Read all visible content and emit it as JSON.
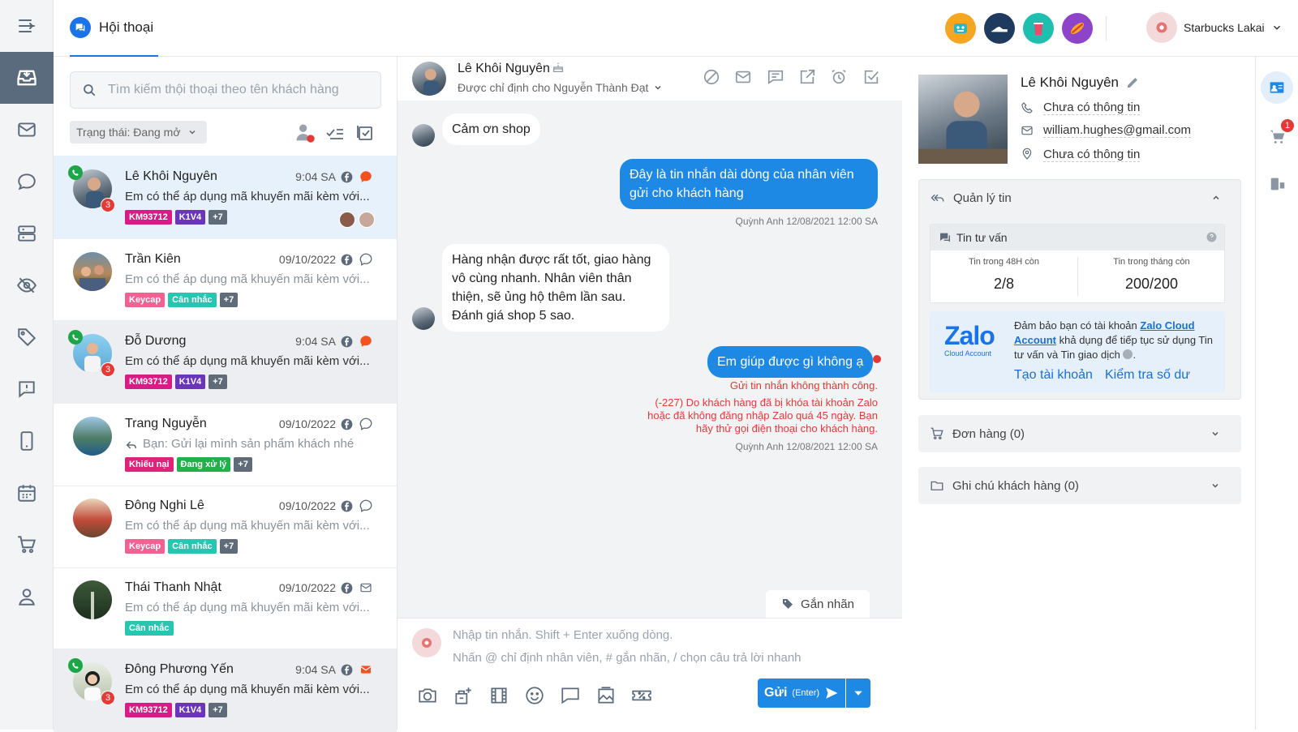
{
  "app": {
    "tab_title": "Hội thoại"
  },
  "account": {
    "name": "Starbucks Lakai"
  },
  "list": {
    "search_placeholder": "Tìm kiếm thội thoại theo tên khách hàng",
    "status_filter": "Trạng thái: Đang mở",
    "conversations": [
      {
        "name": "Lê Khôi Nguyên",
        "time": "9:04 SA",
        "preview": "Em có thể áp dụng mã khuyến mãi kèm với...",
        "tags": [
          {
            "text": "KM93712",
            "color": "#d81b86"
          },
          {
            "text": "K1V4",
            "color": "#6a35b8"
          },
          {
            "text": "+7",
            "color": "#5f6b78"
          }
        ],
        "badge": "3"
      },
      {
        "name": "Trần Kiên",
        "time": "09/10/2022",
        "preview": "Em có thể áp dụng mã khuyến mãi kèm với...",
        "tags": [
          {
            "text": "Keycap",
            "color": "#f06292"
          },
          {
            "text": "Cân nhắc",
            "color": "#26c6b0"
          },
          {
            "text": "+7",
            "color": "#5f6b78"
          }
        ]
      },
      {
        "name": "Đỗ Dương",
        "time": "9:04 SA",
        "preview": "Em có thể áp dụng mã khuyến mãi kèm với...",
        "tags": [
          {
            "text": "KM93712",
            "color": "#d81b86"
          },
          {
            "text": "K1V4",
            "color": "#6a35b8"
          },
          {
            "text": "+7",
            "color": "#5f6b78"
          }
        ],
        "badge": "3"
      },
      {
        "name": "Trang Nguyễn",
        "time": "09/10/2022",
        "preview": "Bạn: Gửi lại mình sản phẩm khách nhé",
        "tags": [
          {
            "text": "Khiếu nại",
            "color": "#e0237a"
          },
          {
            "text": "Đang xử lý",
            "color": "#22b04b"
          },
          {
            "text": "+7",
            "color": "#5f6b78"
          }
        ]
      },
      {
        "name": "Đông Nghi Lê",
        "time": "09/10/2022",
        "preview": "Em có thể áp dụng mã khuyến mãi kèm với...",
        "tags": [
          {
            "text": "Keycap",
            "color": "#f06292"
          },
          {
            "text": "Cân nhắc",
            "color": "#26c6b0"
          },
          {
            "text": "+7",
            "color": "#5f6b78"
          }
        ]
      },
      {
        "name": "Thái Thanh Nhật",
        "time": "09/10/2022",
        "preview": "Em có thể áp dụng mã khuyến mãi kèm với...",
        "tags": [
          {
            "text": "Cân nhắc",
            "color": "#26c6b0"
          }
        ]
      },
      {
        "name": "Đông Phương Yến",
        "time": "9:04 SA",
        "preview": "Em có thể áp dụng mã khuyến mãi kèm với...",
        "tags": [
          {
            "text": "KM93712",
            "color": "#d81b86"
          },
          {
            "text": "K1V4",
            "color": "#6a35b8"
          },
          {
            "text": "+7",
            "color": "#5f6b78"
          }
        ],
        "badge": "3"
      }
    ]
  },
  "chat": {
    "contact_name": "Lê Khôi Nguyên",
    "assigned": "Được chỉ định cho Nguyễn Thành Đạt",
    "messages": {
      "m1": "Cảm ơn shop",
      "m2": "Đây là tin nhắn dài dòng của nhân viên gửi cho khách hàng",
      "m2_meta": "Quỳnh Anh 12/08/2021 12:00 SA",
      "m3": "Hàng nhận được rất tốt, giao hàng vô cùng nhanh. Nhân viên thân thiện, sẽ ủng hộ thêm lần sau. Đánh giá shop 5 sao.",
      "m4": "Em giúp được gì không ạ",
      "m4_error_title": "Gửi tin nhắn không thành công.",
      "m4_error_detail": "(-227) Do khách hàng đã bị khóa tài khoản Zalo hoặc đã không đăng nhập Zalo quá 45 ngày. Bạn hãy thử gọi điện thoại cho khách hàng.",
      "m4_meta": "Quỳnh Anh 12/08/2021 12:00 SA"
    },
    "label_button": "Gắn nhãn",
    "composer_line1": "Nhập tin nhắn. Shift + Enter xuống dòng.",
    "composer_line2": "Nhấn @ chỉ định nhân viên, # gắn nhãn, / chọn câu trả lời nhanh",
    "send_label": "Gửi",
    "send_hint": "(Enter)"
  },
  "customer": {
    "name": "Lê Khôi Nguyên",
    "phone": "Chưa có thông tin",
    "email": "william.hughes@gmail.com",
    "address": "Chưa có thông tin"
  },
  "quota": {
    "section_title": "Quản lý tin",
    "card_title": "Tin tư vấn",
    "left_label": "Tin trong 48H còn",
    "left_value": "2/8",
    "right_label": "Tin trong tháng còn",
    "right_value": "200/200"
  },
  "zalo": {
    "logo_text": "Zalo",
    "logo_sub": "Cloud Account",
    "text_a": "Đảm bảo bạn có tài khoản",
    "text_link": "Zalo Cloud Account",
    "text_b": "khả dụng để tiếp tục sử dụng Tin tư vấn và Tin giao dịch",
    "create_account": "Tạo tài khoản",
    "check_balance": "Kiểm tra số dư"
  },
  "orders": {
    "title": "Đơn hàng (0)"
  },
  "notes": {
    "title": "Ghi chú khách hàng (0)"
  },
  "cart_badge": "1",
  "colors": {
    "primary": "#1e88e5",
    "sidebar_active": "#5a6b7d",
    "error": "#e53935"
  }
}
